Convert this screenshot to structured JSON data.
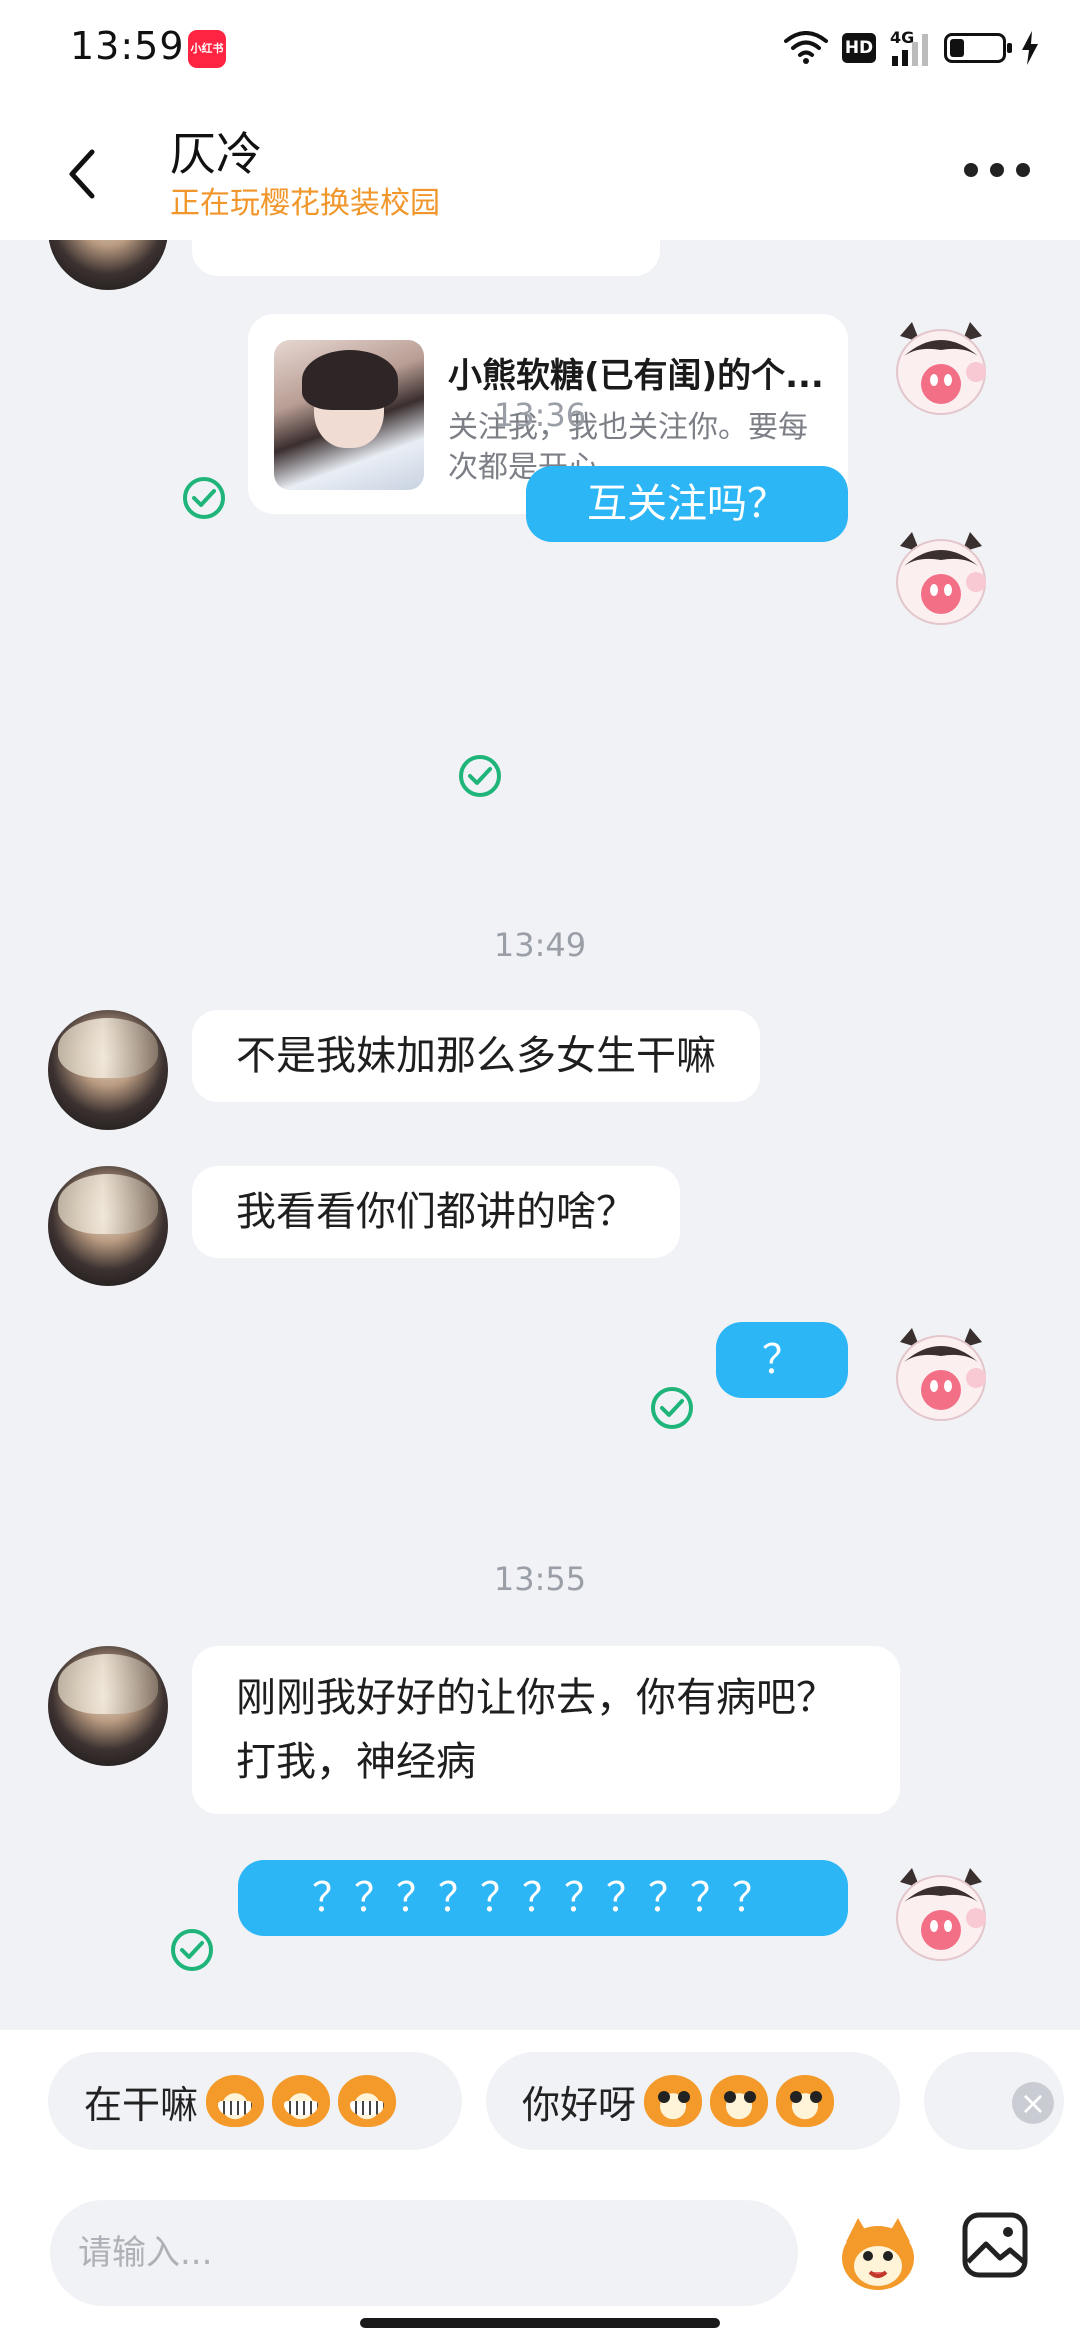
{
  "status_bar": {
    "time": "13:59",
    "app_icon_label": "小红书",
    "hd": "HD",
    "network": "4G",
    "battery": "low"
  },
  "header": {
    "contact_name": "仄冷",
    "status": "正在玩樱花换装校园"
  },
  "messages": {
    "card": {
      "title": "小熊软糖(已有闺)的个...",
      "description": "关注我，我也关注你。要每次都是开心..."
    },
    "time_1": "13:36",
    "out_1": "互关注吗？",
    "time_2": "13:49",
    "in_1": "不是我妹加那么多女生干嘛",
    "in_2": "我看看你们都讲的啥？",
    "out_2": "？",
    "time_3": "13:55",
    "in_3": "刚刚我好好的让你去，你有病吧？打我，神经病",
    "out_3": "？？？？？？？？？？？"
  },
  "quick_replies": [
    {
      "label": "在干嘛",
      "emoji": "grin"
    },
    {
      "label": "你好呀",
      "emoji": "wave"
    }
  ],
  "input": {
    "placeholder": "请输入..."
  },
  "colors": {
    "outgoing_bubble": "#2cb6f6",
    "incoming_bubble": "#ffffff",
    "status_orange": "#f0962a",
    "read_check": "#1fb57a",
    "background": "#f0f2f6"
  }
}
